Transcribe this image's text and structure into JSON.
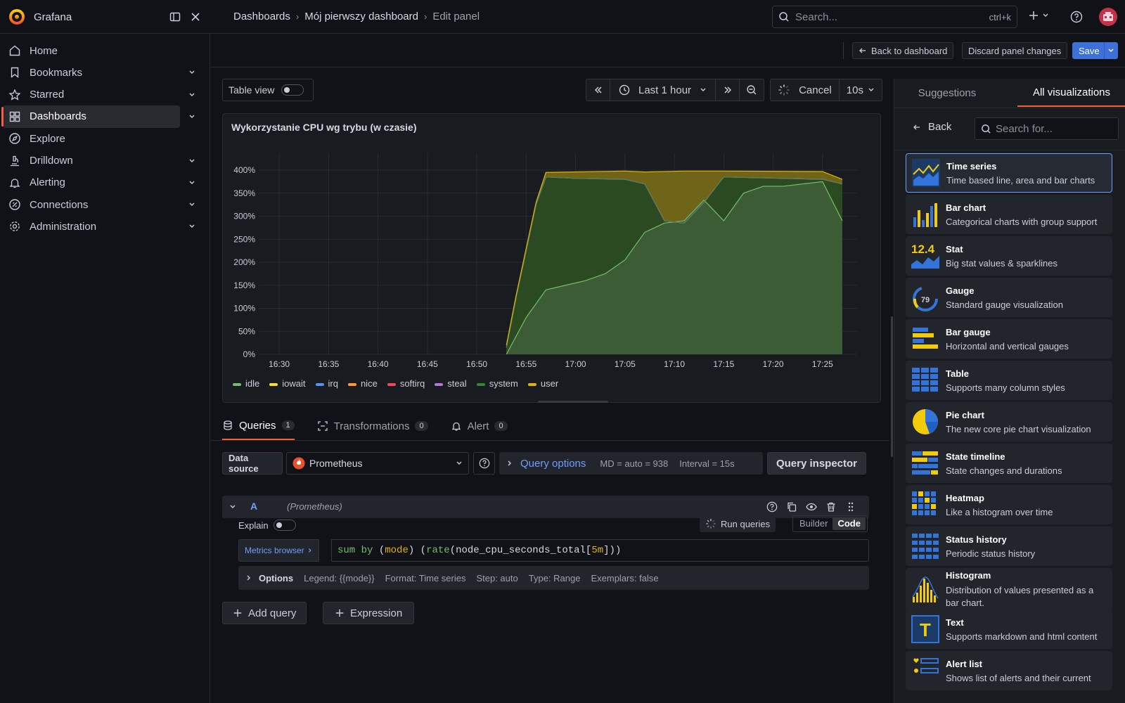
{
  "app": {
    "name": "Grafana"
  },
  "breadcrumb": [
    "Dashboards",
    "Mój pierwszy dashboard",
    "Edit panel"
  ],
  "search": {
    "placeholder": "Search...",
    "shortcut": "ctrl+k"
  },
  "nav": [
    {
      "label": "Home",
      "icon": "home-icon",
      "expandable": false
    },
    {
      "label": "Bookmarks",
      "icon": "bookmark-icon",
      "expandable": true
    },
    {
      "label": "Starred",
      "icon": "star-icon",
      "expandable": true
    },
    {
      "label": "Dashboards",
      "icon": "dashboards-icon",
      "expandable": true,
      "active": true
    },
    {
      "label": "Explore",
      "icon": "compass-icon",
      "expandable": false
    },
    {
      "label": "Drilldown",
      "icon": "microscope-icon",
      "expandable": true
    },
    {
      "label": "Alerting",
      "icon": "bell-icon",
      "expandable": true
    },
    {
      "label": "Connections",
      "icon": "connections-icon",
      "expandable": true
    },
    {
      "label": "Administration",
      "icon": "gear-icon",
      "expandable": true
    }
  ],
  "actions": {
    "back": "Back to dashboard",
    "discard": "Discard panel changes",
    "save": "Save"
  },
  "toolbar": {
    "table_view": "Table view",
    "time_range": "Last 1 hour",
    "cancel": "Cancel",
    "refresh": "10s"
  },
  "panel": {
    "title": "Wykorzystanie CPU wg trybu (w czasie)"
  },
  "chart_data": {
    "type": "area",
    "title": "Wykorzystanie CPU wg trybu (w czasie)",
    "x": [
      "16:30",
      "16:35",
      "16:40",
      "16:45",
      "16:50",
      "16:55",
      "17:00",
      "17:05",
      "17:10",
      "17:15",
      "17:20",
      "17:25"
    ],
    "y_ticks": [
      "0%",
      "50%",
      "100%",
      "150%",
      "200%",
      "250%",
      "300%",
      "350%",
      "400%"
    ],
    "ylim": [
      0,
      400
    ],
    "stacked": true,
    "series": [
      {
        "name": "idle",
        "color": "#73bf69"
      },
      {
        "name": "iowait",
        "color": "#fade2a"
      },
      {
        "name": "irq",
        "color": "#5794f2"
      },
      {
        "name": "nice",
        "color": "#ff9830"
      },
      {
        "name": "softirq",
        "color": "#f2495c"
      },
      {
        "name": "steal",
        "color": "#b877d9"
      },
      {
        "name": "system",
        "color": "#37872d"
      },
      {
        "name": "user",
        "color": "#e0b400"
      }
    ],
    "user_area": {
      "times": [
        "16:53",
        "16:55",
        "16:57",
        "16:59",
        "17:01",
        "17:03",
        "17:05",
        "17:07",
        "17:09",
        "17:11",
        "17:13",
        "17:15",
        "17:17",
        "17:19",
        "17:21",
        "17:23",
        "17:25",
        "17:27"
      ],
      "values": [
        0,
        80,
        140,
        150,
        160,
        175,
        205,
        265,
        285,
        290,
        335,
        290,
        350,
        365,
        365,
        370,
        375,
        290
      ]
    },
    "total_area": {
      "times": [
        "16:53",
        "16:54",
        "16:56",
        "16:57",
        "17:05",
        "17:07",
        "17:11",
        "17:13",
        "17:15",
        "17:25",
        "17:27"
      ],
      "values": [
        20,
        130,
        330,
        395,
        398,
        396,
        398,
        398,
        398,
        397,
        380
      ]
    },
    "system_top": {
      "times": [
        "16:53",
        "16:54",
        "16:56",
        "16:57",
        "17:00",
        "17:05",
        "17:07",
        "17:09",
        "17:11",
        "17:13",
        "17:15",
        "17:25",
        "17:27"
      ],
      "values": [
        15,
        125,
        325,
        385,
        382,
        380,
        370,
        290,
        285,
        330,
        385,
        380,
        370
      ]
    }
  },
  "query_tabs": [
    {
      "label": "Queries",
      "count": "1",
      "active": true
    },
    {
      "label": "Transformations",
      "count": "0"
    },
    {
      "label": "Alert",
      "count": "0"
    }
  ],
  "datasource": {
    "label": "Data source",
    "value": "Prometheus"
  },
  "query_options": {
    "label": "Query options",
    "md": "MD = auto = 938",
    "interval": "Interval = 15s",
    "inspector": "Query inspector"
  },
  "query": {
    "ref": "A",
    "ds": "(Prometheus)",
    "explain": "Explain",
    "run": "Run queries",
    "builder": "Builder",
    "code": "Code",
    "metrics_browser": "Metrics browser",
    "expr": "sum by (mode) (rate(node_cpu_seconds_total[5m]))"
  },
  "options": {
    "label": "Options",
    "legend": "Legend: {{mode}}",
    "format": "Format: Time series",
    "step": "Step: auto",
    "type": "Type: Range",
    "exemplars": "Exemplars: false"
  },
  "add": {
    "query": "Add query",
    "expression": "Expression"
  },
  "viz": {
    "tabs": [
      "Suggestions",
      "All visualizations"
    ],
    "back": "Back",
    "search_placeholder": "Search for...",
    "items": [
      {
        "title": "Time series",
        "desc": "Time based line, area and bar charts",
        "icon": "time-series-icon",
        "selected": true
      },
      {
        "title": "Bar chart",
        "desc": "Categorical charts with group support",
        "icon": "bar-chart-icon"
      },
      {
        "title": "Stat",
        "desc": "Big stat values & sparklines",
        "icon": "stat-icon",
        "icon_text": "12.4"
      },
      {
        "title": "Gauge",
        "desc": "Standard gauge visualization",
        "icon": "gauge-icon",
        "icon_text": "79"
      },
      {
        "title": "Bar gauge",
        "desc": "Horizontal and vertical gauges",
        "icon": "bar-gauge-icon"
      },
      {
        "title": "Table",
        "desc": "Supports many column styles",
        "icon": "table-icon"
      },
      {
        "title": "Pie chart",
        "desc": "The new core pie chart visualization",
        "icon": "pie-chart-icon"
      },
      {
        "title": "State timeline",
        "desc": "State changes and durations",
        "icon": "state-timeline-icon"
      },
      {
        "title": "Heatmap",
        "desc": "Like a histogram over time",
        "icon": "heatmap-icon"
      },
      {
        "title": "Status history",
        "desc": "Periodic status history",
        "icon": "status-history-icon"
      },
      {
        "title": "Histogram",
        "desc": "Distribution of values presented as a bar chart.",
        "icon": "histogram-icon"
      },
      {
        "title": "Text",
        "desc": "Supports markdown and html content",
        "icon": "text-icon",
        "icon_text": "T"
      },
      {
        "title": "Alert list",
        "desc": "Shows list of alerts and their current",
        "icon": "alert-list-icon"
      }
    ]
  }
}
